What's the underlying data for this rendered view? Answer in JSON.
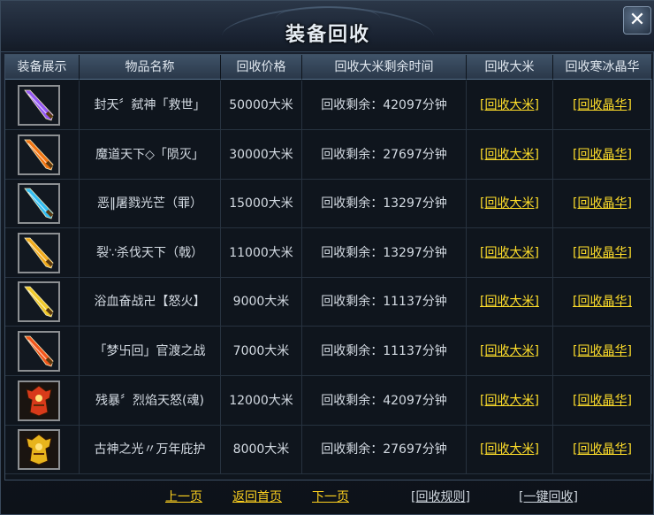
{
  "window": {
    "title": "装备回收",
    "close_label": "✕"
  },
  "table": {
    "headers": [
      "装备展示",
      "物品名称",
      "回收价格",
      "回收大米剩余时间",
      "回收大米",
      "回收寒冰晶华"
    ],
    "rows": [
      {
        "name": "封天〞弑神「救世」",
        "price": "50000大米",
        "remain": "回收剩余：42097分钟",
        "rice": "[回收大米]",
        "crystal": "[回收晶华]",
        "icon": "purple-sword-icon",
        "color": "#9b5cff"
      },
      {
        "name": "魔道天下◇「陨灭」",
        "price": "30000大米",
        "remain": "回收剩余：27697分钟",
        "rice": "[回收大米]",
        "crystal": "[回收晶华]",
        "icon": "fire-blade-icon",
        "color": "#ff7a12"
      },
      {
        "name": "恶‖屠戮光芒（罪）",
        "price": "15000大米",
        "remain": "回收剩余：13297分钟",
        "rice": "[回收大米]",
        "crystal": "[回收晶华]",
        "icon": "cyan-blade-icon",
        "color": "#34c7ff"
      },
      {
        "name": "裂∵杀伐天下（戟）",
        "price": "11000大米",
        "remain": "回收剩余：13297分钟",
        "rice": "[回收大米]",
        "crystal": "[回收晶华]",
        "icon": "golden-halberd-icon",
        "color": "#ffb21a"
      },
      {
        "name": "浴血奋战卍【怒火】",
        "price": "9000大米",
        "remain": "回收剩余：11137分钟",
        "rice": "[回收大米]",
        "crystal": "[回收晶华]",
        "icon": "golden-sword-icon",
        "color": "#ffd42a"
      },
      {
        "name": "「梦卐回」官渡之战",
        "price": "7000大米",
        "remain": "回收剩余：11137分钟",
        "rice": "[回收大米]",
        "crystal": "[回收晶华]",
        "icon": "flame-sword-icon",
        "color": "#ff5a1a"
      },
      {
        "name": "残暴〞烈焰天怒(魂)",
        "price": "12000大米",
        "remain": "回收剩余：42097分钟",
        "rice": "[回收大米]",
        "crystal": "[回收晶华]",
        "icon": "red-armor-icon",
        "color": "#d83a1a"
      },
      {
        "name": "古神之光〃万年庇护",
        "price": "8000大米",
        "remain": "回收剩余：27697分钟",
        "rice": "[回收大米]",
        "crystal": "[回收晶华]",
        "icon": "gold-armor-icon",
        "color": "#e8b41c"
      }
    ]
  },
  "footer": {
    "prev": "上一页",
    "home": "返回首页",
    "next": "下一页",
    "rules": "[回收规则]",
    "one_click": "[一键回收]"
  }
}
